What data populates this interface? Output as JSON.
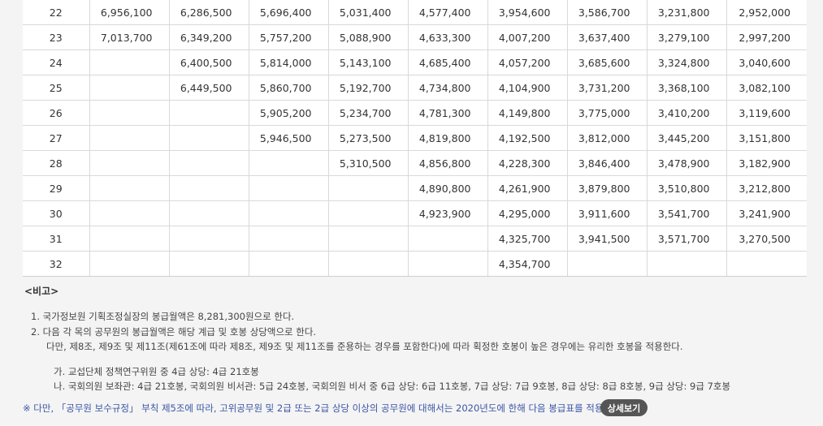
{
  "table": {
    "rows": [
      {
        "grade": "22",
        "cells": [
          "6,956,100",
          "6,286,500",
          "5,696,400",
          "5,031,400",
          "4,577,400",
          "3,954,600",
          "3,586,700",
          "3,231,800",
          "2,952,000"
        ]
      },
      {
        "grade": "23",
        "cells": [
          "7,013,700",
          "6,349,200",
          "5,757,200",
          "5,088,900",
          "4,633,300",
          "4,007,200",
          "3,637,400",
          "3,279,100",
          "2,997,200"
        ]
      },
      {
        "grade": "24",
        "cells": [
          "",
          "6,400,500",
          "5,814,000",
          "5,143,100",
          "4,685,400",
          "4,057,200",
          "3,685,600",
          "3,324,800",
          "3,040,600"
        ]
      },
      {
        "grade": "25",
        "cells": [
          "",
          "6,449,500",
          "5,860,700",
          "5,192,700",
          "4,734,800",
          "4,104,900",
          "3,731,200",
          "3,368,100",
          "3,082,100"
        ]
      },
      {
        "grade": "26",
        "cells": [
          "",
          "",
          "5,905,200",
          "5,234,700",
          "4,781,300",
          "4,149,800",
          "3,775,000",
          "3,410,200",
          "3,119,600"
        ]
      },
      {
        "grade": "27",
        "cells": [
          "",
          "",
          "5,946,500",
          "5,273,500",
          "4,819,800",
          "4,192,500",
          "3,812,000",
          "3,445,200",
          "3,151,800"
        ]
      },
      {
        "grade": "28",
        "cells": [
          "",
          "",
          "",
          "5,310,500",
          "4,856,800",
          "4,228,300",
          "3,846,400",
          "3,478,900",
          "3,182,900"
        ]
      },
      {
        "grade": "29",
        "cells": [
          "",
          "",
          "",
          "",
          "4,890,800",
          "4,261,900",
          "3,879,800",
          "3,510,800",
          "3,212,800"
        ]
      },
      {
        "grade": "30",
        "cells": [
          "",
          "",
          "",
          "",
          "4,923,900",
          "4,295,000",
          "3,911,600",
          "3,541,700",
          "3,241,900"
        ]
      },
      {
        "grade": "31",
        "cells": [
          "",
          "",
          "",
          "",
          "",
          "4,325,700",
          "3,941,500",
          "3,571,700",
          "3,270,500"
        ]
      },
      {
        "grade": "32",
        "cells": [
          "",
          "",
          "",
          "",
          "",
          "4,354,700",
          "",
          "",
          ""
        ]
      }
    ]
  },
  "remarks": {
    "title": "<비고>",
    "item1": "1.  국가정보원 기획조정실장의 봉급월액은 8,281,300원으로 한다.",
    "item2": "2.  다음 각 목의 공무원의 봉급월액은 해당 계급 및 호봉 상당액으로 한다.",
    "item2_sub": "다만, 제8조, 제9조 및 제11조(제61조에 따라 제8조, 제9조 및 제11조를 준용하는 경우를 포함한다)에 따라 획정한 호봉이 높은 경우에는 유리한 호봉을 적용한다.",
    "item_ga": "가.  교섭단체 정책연구위원 중 4급 상당: 4급 21호봉",
    "item_na": "나.  국회의원 보좌관: 4급 21호봉, 국회의원 비서관: 5급 24호봉, 국회의원 비서 중 6급 상당: 6급 11호봉, 7급 상당: 7급 9호봉, 8급 상당: 8급 8호봉, 9급 상당: 9급 7호봉"
  },
  "footer": {
    "note": "※  다만, 「공무원 보수규정」 부칙 제5조에 따라, 고위공무원 및 2급 또는 2급 상당 이상의 공무원에 대해서는 2020년도에 한해 다음 봉급표를 적용한다.",
    "button_label": "상세보기"
  }
}
